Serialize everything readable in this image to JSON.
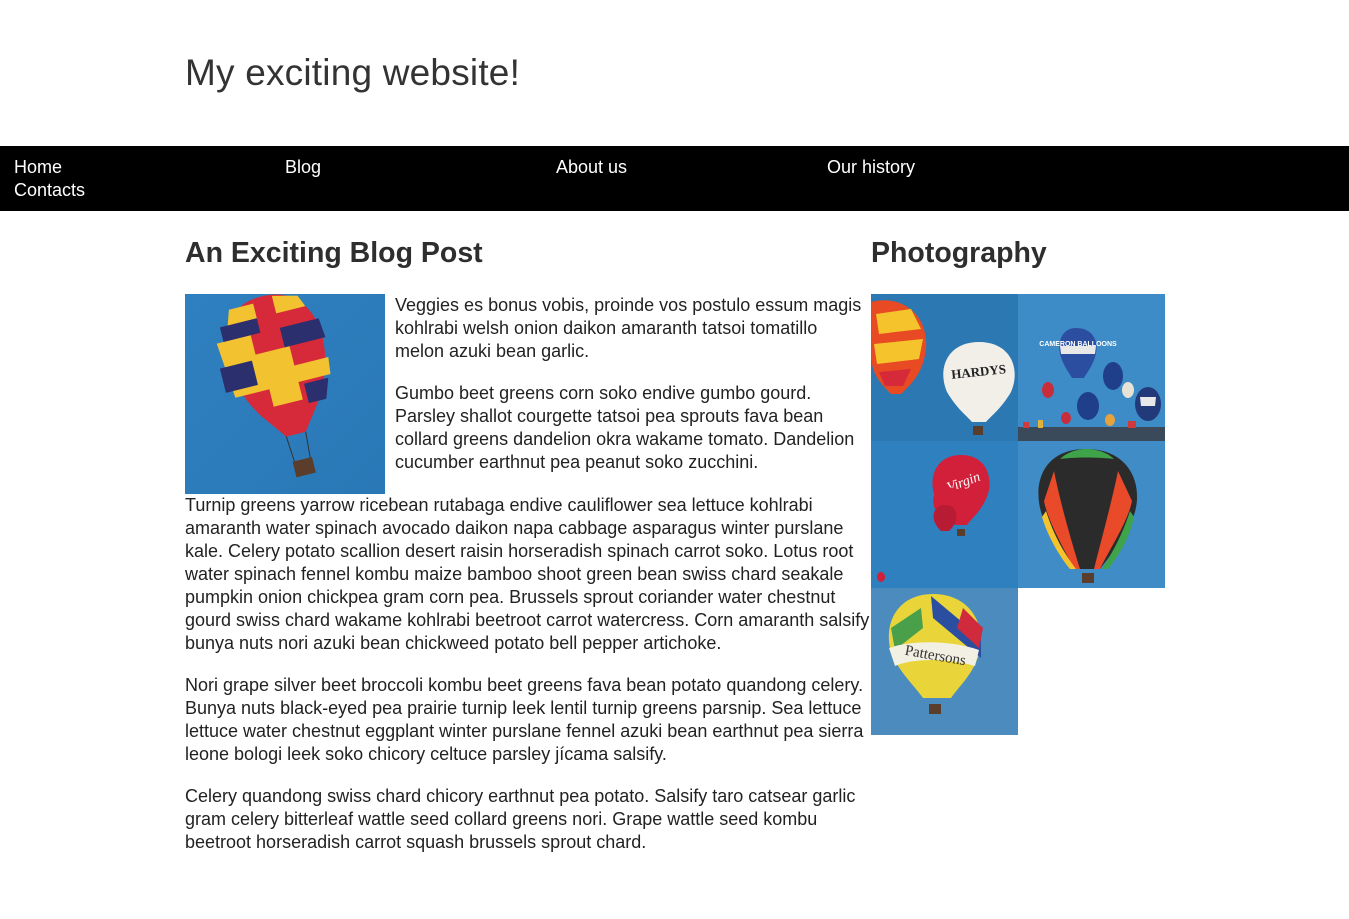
{
  "site": {
    "title": "My exciting website!"
  },
  "nav": {
    "items": [
      {
        "label": "Home"
      },
      {
        "label": "Blog"
      },
      {
        "label": "About us"
      },
      {
        "label": "Our history"
      },
      {
        "label": "Contacts"
      }
    ]
  },
  "post": {
    "title": "An Exciting Blog Post",
    "paragraphs": [
      "Veggies es bonus vobis, proinde vos postulo essum magis kohlrabi welsh onion daikon amaranth tatsoi tomatillo melon azuki bean garlic.",
      "Gumbo beet greens corn soko endive gumbo gourd. Parsley shallot courgette tatsoi pea sprouts fava bean collard greens dandelion okra wakame tomato. Dandelion cucumber earthnut pea peanut soko zucchini.",
      "Turnip greens yarrow ricebean rutabaga endive cauliflower sea lettuce kohlrabi amaranth water spinach avocado daikon napa cabbage asparagus winter purslane kale. Celery potato scallion desert raisin horseradish spinach carrot soko. Lotus root water spinach fennel kombu maize bamboo shoot green bean swiss chard seakale pumpkin onion chickpea gram corn pea. Brussels sprout coriander water chestnut gourd swiss chard wakame kohlrabi beetroot carrot watercress. Corn amaranth salsify bunya nuts nori azuki bean chickweed potato bell pepper artichoke.",
      "Nori grape silver beet broccoli kombu beet greens fava bean potato quandong celery. Bunya nuts black-eyed pea prairie turnip leek lentil turnip greens parsnip. Sea lettuce lettuce water chestnut eggplant winter purslane fennel azuki bean earthnut pea sierra leone bologi leek soko chicory celtuce parsley jícama salsify.",
      "Celery quandong swiss chard chicory earthnut pea potato. Salsify taro catsear garlic gram celery bitterleaf wattle seed collard greens nori. Grape wattle seed kombu beetroot horseradish carrot squash brussels sprout chard."
    ]
  },
  "aside": {
    "title": "Photography",
    "photo_texts": [
      "HARDYS",
      "CAMERON BALLOONS",
      "Virgin",
      "Pattersons"
    ]
  },
  "colors": {
    "nav_bg": "#000000",
    "sky": "#2f86c4",
    "text": "#2e2e2e"
  }
}
